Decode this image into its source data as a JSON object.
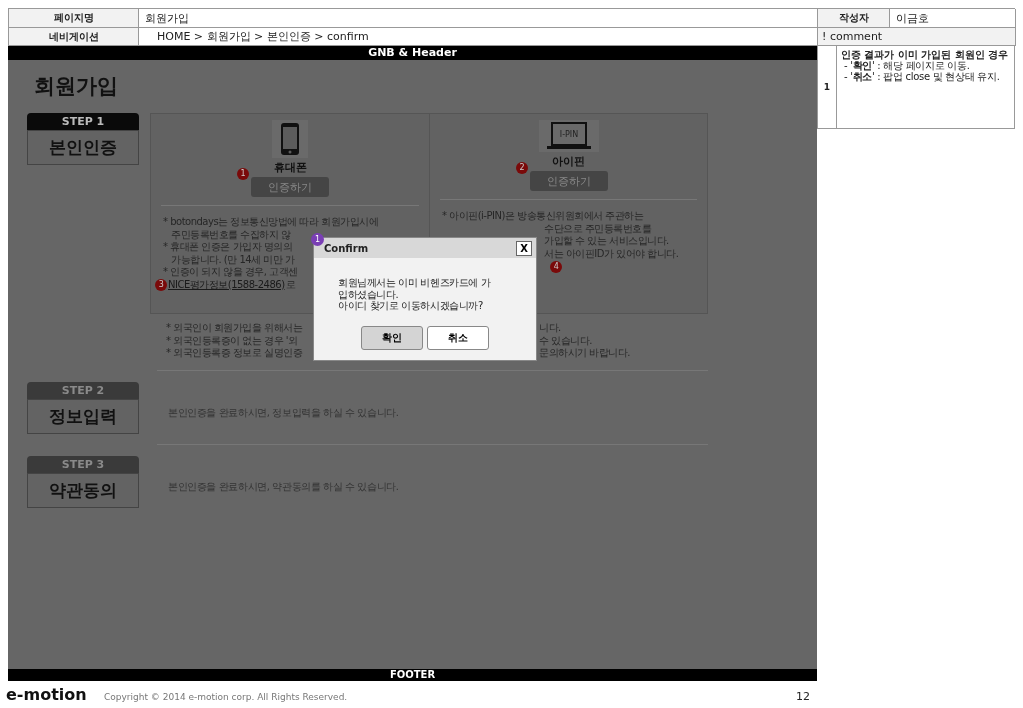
{
  "info_table": {
    "page_label": "페이지명",
    "page_name": "회원가입",
    "author_label": "작성자",
    "author": "이금호",
    "nav_label": "네비게이션",
    "nav": "HOME > 회원가입 > 본인인증 > confirm",
    "comment_label": "! comment"
  },
  "comments": [
    {
      "number": "1",
      "title": "인증 결과가 이미 가입된 회원인 경우",
      "lines": [
        "- '**확인**' : 해당 페이지로 이동.",
        "- '**취소**' : 팝업 close 및 현상태 유지."
      ]
    }
  ],
  "gnb": "GNB & Header",
  "page_title": "회원가입",
  "steps": [
    {
      "label": "STEP 1",
      "name": "본인인증",
      "selected": true
    },
    {
      "label": "STEP 2",
      "name": "정보입력",
      "selected": false,
      "description": "본인인증을 완료하시면, 정보입력을 하실 수 있습니다."
    },
    {
      "label": "STEP 3",
      "name": "약관동의",
      "selected": false,
      "description": "본인인증을 완료하시면, 약관동의를 하실 수 있습니다."
    }
  ],
  "methods": [
    {
      "kind": "phone",
      "name": "휴대폰",
      "button": "인증하기",
      "badge": "1",
      "notes": [
        {
          "kind": "line",
          "text": "* botondays는 정보통신망법에 따라 회원가입시에"
        },
        {
          "kind": "cont",
          "text": "주민등록번호를 수집하지 않"
        },
        {
          "kind": "line",
          "text": "* 휴대폰 인증은 가입자 명의의"
        },
        {
          "kind": "cont",
          "text": "가능합니다. (만 14세 미만 가"
        },
        {
          "kind": "line",
          "text": "* 인증이 되지 않을 경우, 고객센"
        },
        {
          "kind": "link",
          "badge": "3",
          "text": "NICE평가정보(1588-2486)",
          "after": "로"
        }
      ]
    },
    {
      "kind": "ipin",
      "name": "아이핀",
      "icon_text": "I-PIN",
      "button": "인증하기",
      "badge": "2",
      "notes": [
        {
          "kind": "line",
          "text": "* 아이핀(i-PIN)은 방송통신위원회에서 주관하는"
        },
        {
          "kind": "cut",
          "text": "수단으로 주민등록번호를"
        },
        {
          "kind": "cut",
          "text": "가입할 수 있는 서비스입니다."
        },
        {
          "kind": "cut",
          "text": "서는 아이핀ID가 있어야 합니다."
        },
        {
          "kind": "badge",
          "badge": "4"
        }
      ]
    }
  ],
  "foreign_notes": [
    {
      "left": "* 외국인이 회원가입을 위해서는",
      "right": "니다."
    },
    {
      "left": "* 외국인등록증이 없는 경우 '외",
      "right": "수 있습니다."
    },
    {
      "left": "* 외국인등록증 정보로 실명인증",
      "right": "문의하시기 바랍니다."
    }
  ],
  "dialog": {
    "badge": "1",
    "title": "Confirm",
    "close": "X",
    "message": [
      "회원님께서는 이미 비헨즈카드에 가",
      "입하셨습니다.",
      "아이디 찾기로 이동하시겠습니까?"
    ],
    "buttons": [
      {
        "label": "확인",
        "primary": true
      },
      {
        "label": "취소",
        "primary": false
      }
    ]
  },
  "footer": "FOOTER",
  "bottom": {
    "logo": "e-motion",
    "copyright": "Copyright © 2014 e-motion corp. All Rights Reserved.",
    "page_number": "12"
  }
}
